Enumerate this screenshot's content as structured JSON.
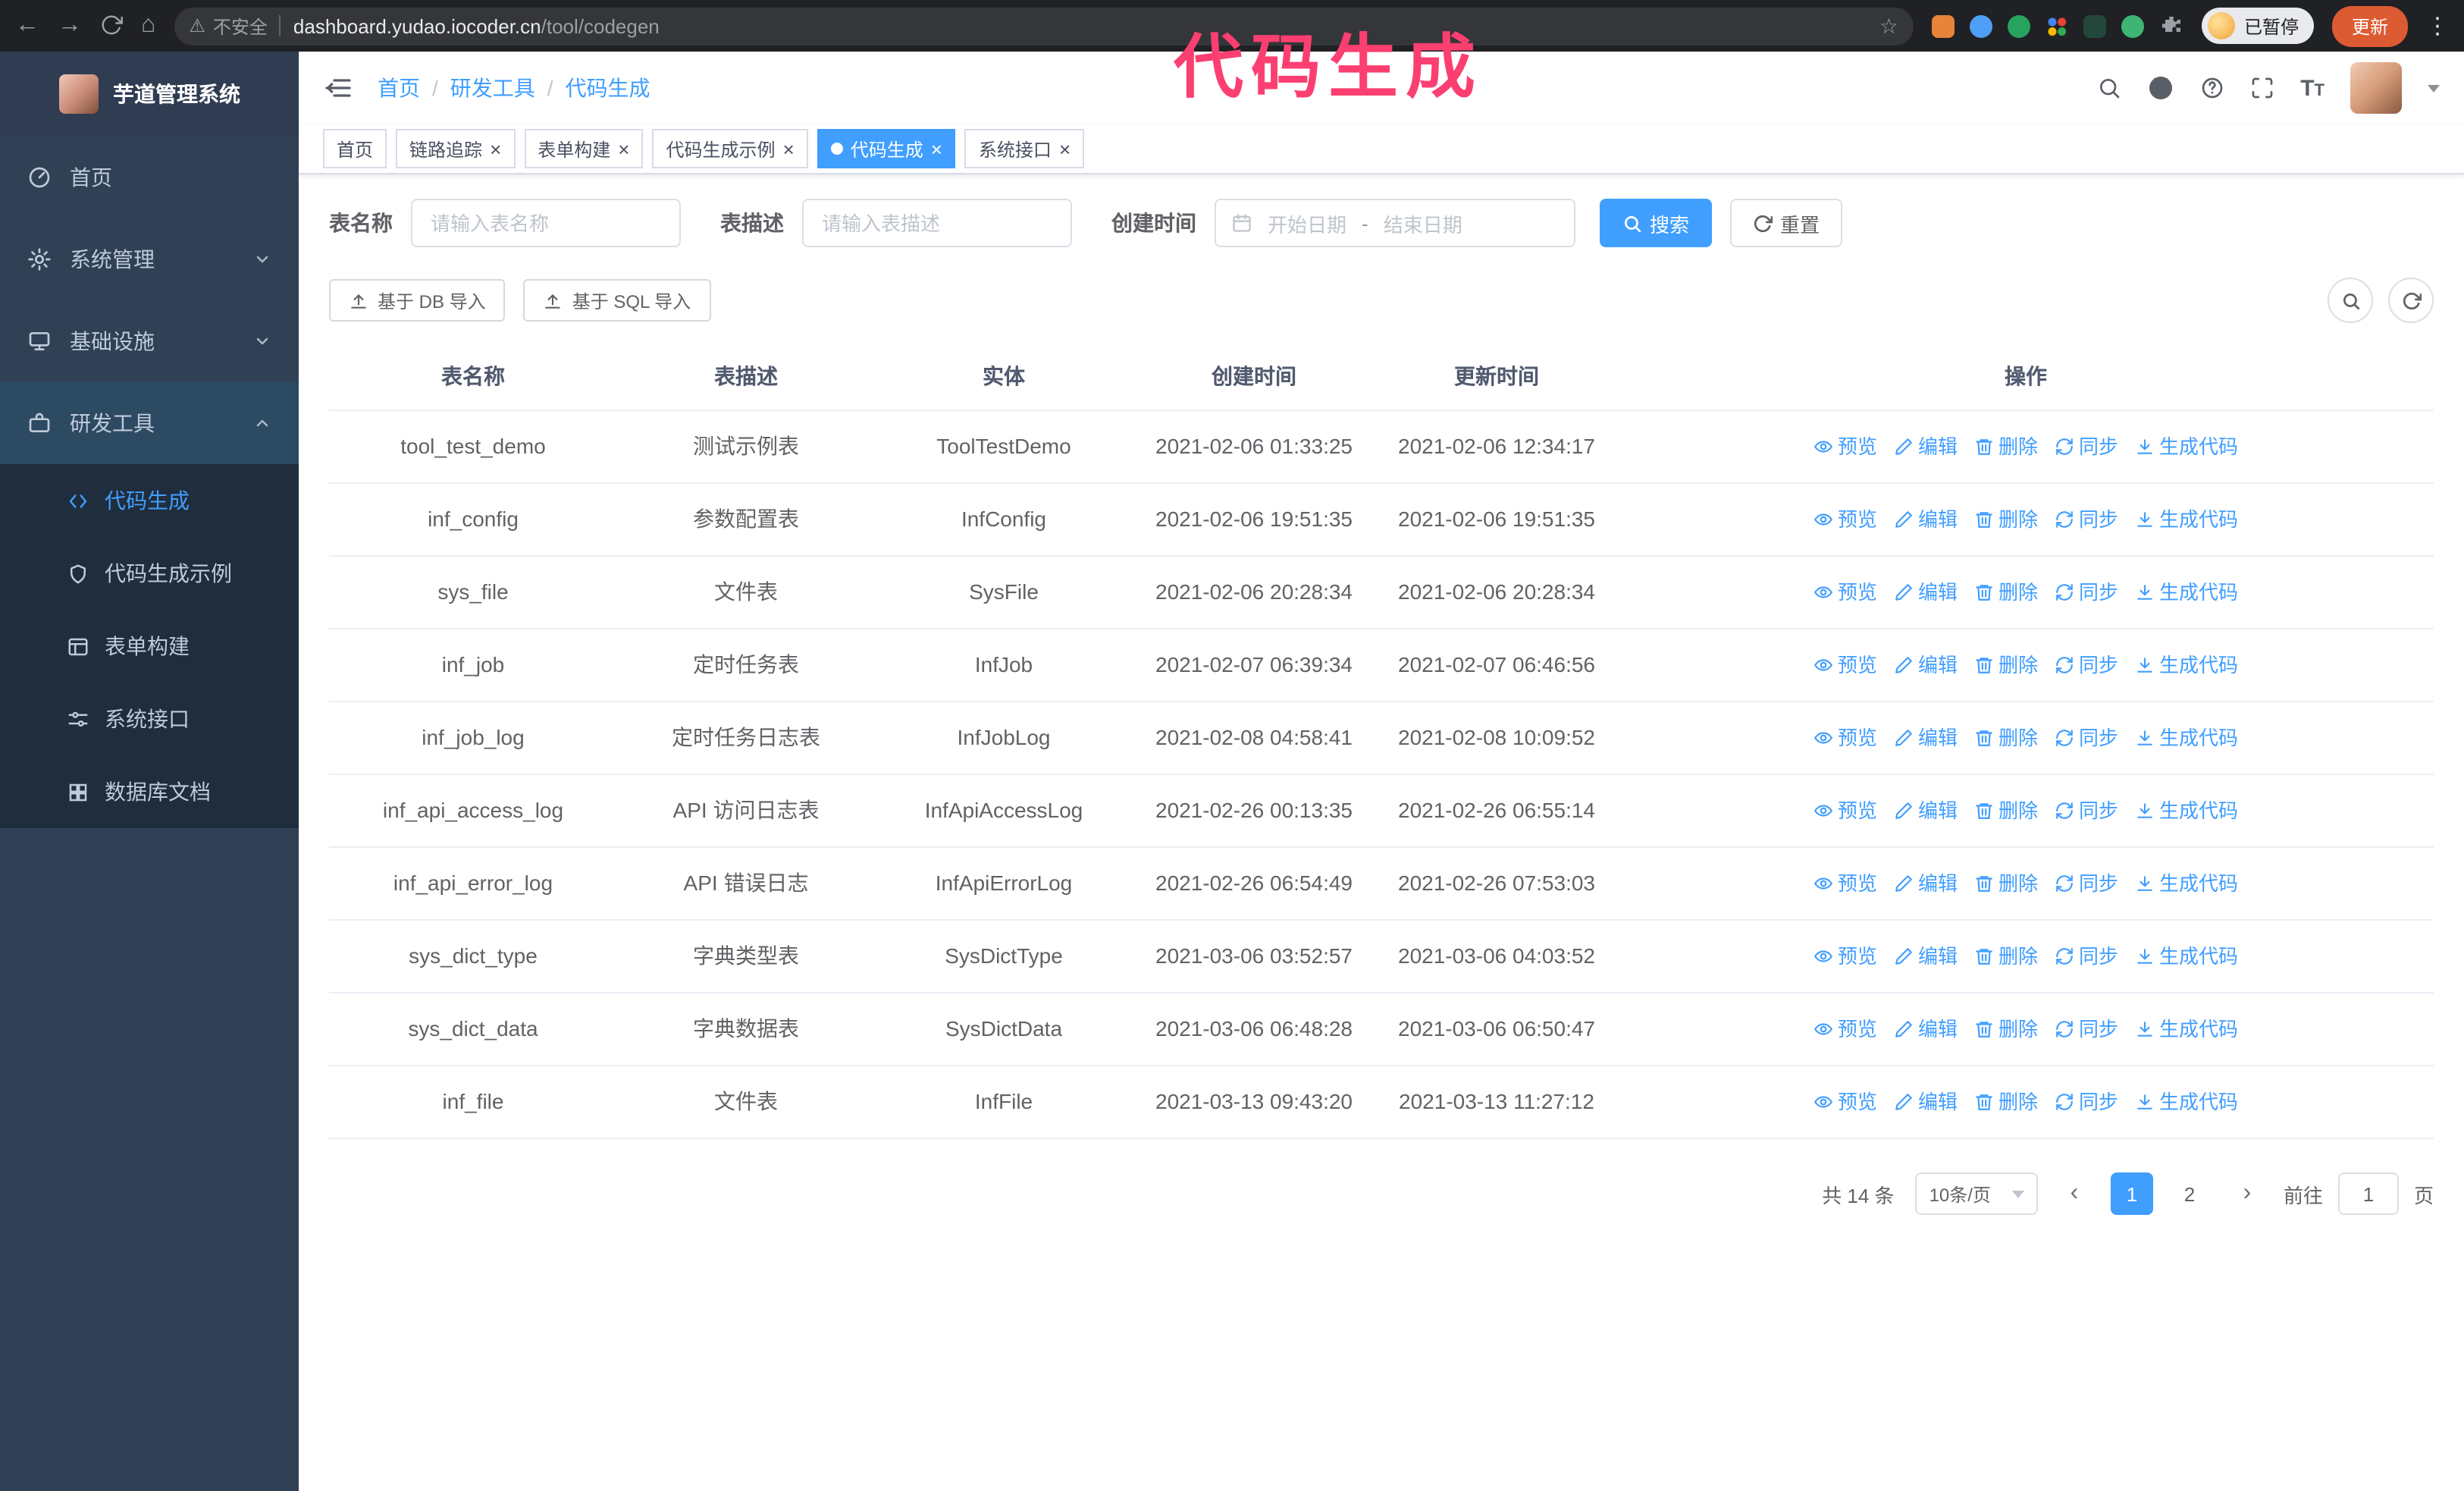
{
  "glyphs": {
    "back": "←",
    "forward": "→",
    "home": "⌂",
    "star": "☆",
    "warning": "⚠",
    "omni_sep": "|",
    "kebab": "⋮",
    "close": "×",
    "breadcrumb_sep": "/",
    "prev": "‹",
    "next": "›",
    "dash": "-"
  },
  "browser": {
    "security_label": "不安全",
    "url_host": "dashboard.yudao.iocoder.cn",
    "url_path": "/tool/codegen",
    "paused_badge": "已暂停",
    "update_button": "更新"
  },
  "annotation": {
    "text": "代码生成"
  },
  "sidebar": {
    "logo_title": "芋道管理系统",
    "items": [
      {
        "label": "首页",
        "icon": "dashboard-icon"
      },
      {
        "label": "系统管理",
        "icon": "gear-icon"
      },
      {
        "label": "基础设施",
        "icon": "monitor-icon"
      },
      {
        "label": "研发工具",
        "icon": "toolbox-icon"
      }
    ],
    "subitems": [
      {
        "label": "代码生成",
        "icon": "code-icon",
        "active": true
      },
      {
        "label": "代码生成示例",
        "icon": "shield-icon"
      },
      {
        "label": "表单构建",
        "icon": "form-icon"
      },
      {
        "label": "系统接口",
        "icon": "sliders-icon"
      },
      {
        "label": "数据库文档",
        "icon": "grid-icon"
      }
    ]
  },
  "header": {
    "breadcrumb": [
      "首页",
      "研发工具",
      "代码生成"
    ]
  },
  "tabs": [
    {
      "label": "首页",
      "closable": false,
      "active": false
    },
    {
      "label": "链路追踪",
      "closable": true,
      "active": false
    },
    {
      "label": "表单构建",
      "closable": true,
      "active": false
    },
    {
      "label": "代码生成示例",
      "closable": true,
      "active": false
    },
    {
      "label": "代码生成",
      "closable": true,
      "active": true
    },
    {
      "label": "系统接口",
      "closable": true,
      "active": false
    }
  ],
  "filters": {
    "table_name_label": "表名称",
    "table_name_placeholder": "请输入表名称",
    "table_desc_label": "表描述",
    "table_desc_placeholder": "请输入表描述",
    "create_time_label": "创建时间",
    "date_start_placeholder": "开始日期",
    "date_end_placeholder": "结束日期",
    "search_button": "搜索",
    "reset_button": "重置"
  },
  "toolbar": {
    "import_db_button": "基于 DB 导入",
    "import_sql_button": "基于 SQL 导入"
  },
  "table": {
    "columns": [
      "表名称",
      "表描述",
      "实体",
      "创建时间",
      "更新时间",
      "操作"
    ],
    "actions": [
      "预览",
      "编辑",
      "删除",
      "同步",
      "生成代码"
    ],
    "rows": [
      {
        "name": "tool_test_demo",
        "desc": "测试示例表",
        "entity": "ToolTestDemo",
        "created": "2021-02-06 01:33:25",
        "updated": "2021-02-06 12:34:17"
      },
      {
        "name": "inf_config",
        "desc": "参数配置表",
        "entity": "InfConfig",
        "created": "2021-02-06 19:51:35",
        "updated": "2021-02-06 19:51:35"
      },
      {
        "name": "sys_file",
        "desc": "文件表",
        "entity": "SysFile",
        "created": "2021-02-06 20:28:34",
        "updated": "2021-02-06 20:28:34"
      },
      {
        "name": "inf_job",
        "desc": "定时任务表",
        "entity": "InfJob",
        "created": "2021-02-07 06:39:34",
        "updated": "2021-02-07 06:46:56"
      },
      {
        "name": "inf_job_log",
        "desc": "定时任务日志表",
        "entity": "InfJobLog",
        "created": "2021-02-08 04:58:41",
        "updated": "2021-02-08 10:09:52"
      },
      {
        "name": "inf_api_access_log",
        "desc": "API 访问日志表",
        "entity": "InfApiAccessLog",
        "created": "2021-02-26 00:13:35",
        "updated": "2021-02-26 06:55:14"
      },
      {
        "name": "inf_api_error_log",
        "desc": "API 错误日志",
        "entity": "InfApiErrorLog",
        "created": "2021-02-26 06:54:49",
        "updated": "2021-02-26 07:53:03"
      },
      {
        "name": "sys_dict_type",
        "desc": "字典类型表",
        "entity": "SysDictType",
        "created": "2021-03-06 03:52:57",
        "updated": "2021-03-06 04:03:52"
      },
      {
        "name": "sys_dict_data",
        "desc": "字典数据表",
        "entity": "SysDictData",
        "created": "2021-03-06 06:48:28",
        "updated": "2021-03-06 06:50:47"
      },
      {
        "name": "inf_file",
        "desc": "文件表",
        "entity": "InfFile",
        "created": "2021-03-13 09:43:20",
        "updated": "2021-03-13 11:27:12"
      }
    ]
  },
  "pagination": {
    "total": "共 14 条",
    "page_size": "10条/页",
    "pages": [
      "1",
      "2"
    ],
    "goto_prefix": "前往",
    "goto_value": "1",
    "goto_suffix": "页"
  }
}
